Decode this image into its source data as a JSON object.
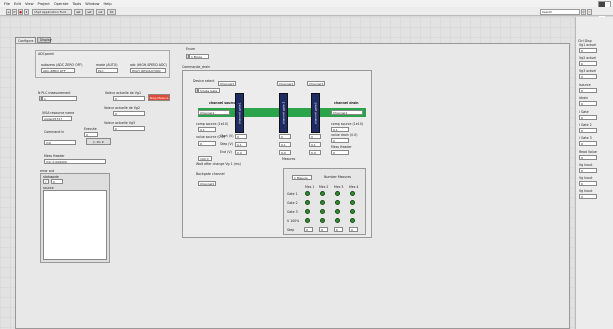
{
  "menu": [
    "File",
    "Edit",
    "View",
    "Project",
    "Operate",
    "Tools",
    "Window",
    "Help"
  ],
  "toolbar": {
    "font": "15pt Application Font",
    "search": "Search"
  },
  "tabs": [
    "Configure",
    "Display"
  ],
  "adc": {
    "group": "ADCparml",
    "autozero_label": "autozero (ADC ZERO OFF)",
    "autozero_value": "ADC ZERO OFF",
    "mode_label": "mode (AUTO)",
    "mode_value": "PLC",
    "adc_label": "adc (HIGH-SPEED ADC)",
    "adc_value": "HIGH_RESOLUTION"
  },
  "left": {
    "nplc_label": "N PLC measurement",
    "nplc_value": "1",
    "visa_label": "VISA resource name",
    "visa_value": "Agilent5727",
    "command_label": "Command in",
    "command_value": "init",
    "mess_label": "Mess Header",
    "mess_value": "Vdc 0.000000",
    "error_label": "error out",
    "status": "status",
    "code": "code",
    "code_value": "0",
    "source": "source"
  },
  "mid": {
    "vg1_label": "Valeur actuelle de Vg1",
    "vg1_value": "0",
    "vg2_label": "Valeur actuelle de Vg2",
    "vg2_value": "0",
    "vg3_label": "Valeur actuelle Vg3",
    "vg3_value": "0",
    "stop_label": "Stop Mesure",
    "execute_label": "Execute",
    "execute_value": "0",
    "doit": "Do it"
  },
  "enum": {
    "label": "Enum",
    "value": "1 Biops"
  },
  "commande": {
    "title": "Commande_drain",
    "device_label": "Device select",
    "device_value": "Single Gate",
    "channels": [
      "Channel1",
      "Channel1",
      "Channel1"
    ],
    "channel_source": "channel source",
    "channel_drain": "channel drain",
    "channel_src_value": "Channel1",
    "channel_drn_value": "Channel1",
    "gates": [
      "channel gate1",
      "channel gate 2",
      "channel gate3"
    ],
    "comp_source_label": "comp source (1e10)",
    "comp_source_value": "0.1",
    "comp_drain_label": "comp source (1e10)",
    "comp_drain_value": "0.1",
    "value_source_label": "value source (0.0)",
    "value_source_value": "0",
    "value_drain_label": "value drain (0.0)",
    "value_drain_value": "0",
    "start_label": "Start (V)",
    "step_label": "Step (V)",
    "end_label": "End (V)",
    "start_value": "0",
    "step_value": "0.1",
    "end_value": "0.0",
    "gate_vals": [
      [
        "0",
        "0",
        "0"
      ],
      [
        "0.1",
        "0.1",
        "0.1"
      ],
      [
        "0.0",
        "0.0",
        "0.0"
      ]
    ],
    "mess_header_label": "Mess Header",
    "mess_header_value": "0",
    "wait_value": "100 0",
    "wait_label": "Wait after change Vg 1 (ms)",
    "backgate_label": "Backgate channel",
    "backgate_value": "Channel1",
    "mesures_label": "Mesures",
    "mesure_select": "1 Mesure",
    "number_mesures": "Number Mesures",
    "mesure_cols": [
      "Mes 1",
      "Mes 2",
      "Mes 3",
      "Mes 4"
    ],
    "mesure_rows": [
      "Gate 1",
      "Gate 2",
      "Gate 3",
      "V 100%",
      "Step"
    ],
    "step_vals": [
      "0",
      "0",
      "0",
      "0"
    ]
  },
  "sidebar": {
    "title": "Ctrl Disp",
    "items": [
      {
        "label": "Vg1 actuel",
        "value": "0"
      },
      {
        "label": "Vg2 actuel",
        "value": "0"
      },
      {
        "label": "Vg3 actuel",
        "value": "0"
      },
      {
        "label": "Isource",
        "value": "0"
      },
      {
        "label": "Idrain",
        "value": "0"
      },
      {
        "label": "I Gate",
        "value": "0"
      },
      {
        "label": "I Gate 2",
        "value": "0"
      },
      {
        "label": "I Gate 3",
        "value": "0"
      },
      {
        "label": "Read Value",
        "value": "0"
      },
      {
        "label": "Vg Inout",
        "value": "0"
      },
      {
        "label": "Vg Inout",
        "value": "0"
      },
      {
        "label": "Vg Inout",
        "value": "0"
      }
    ]
  }
}
